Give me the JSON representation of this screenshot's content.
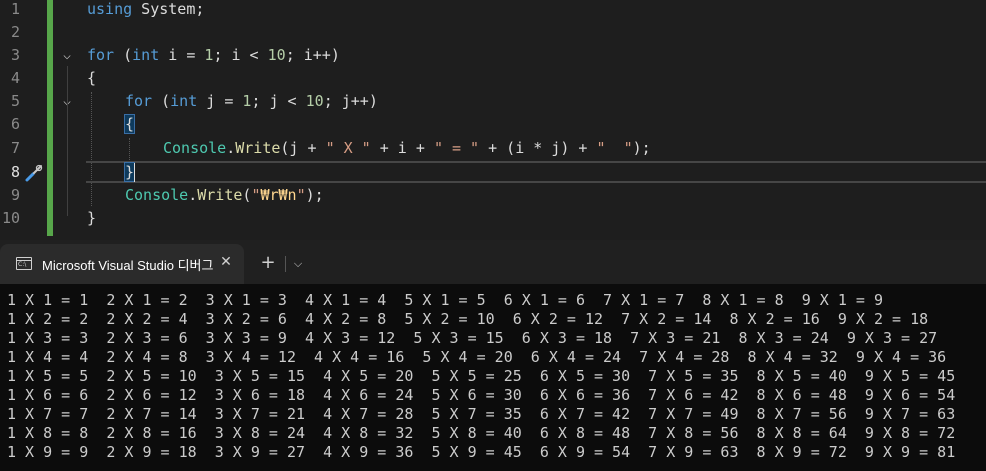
{
  "editor": {
    "line_numbers": [
      "1",
      "2",
      "3",
      "4",
      "5",
      "6",
      "7",
      "8",
      "9",
      "10"
    ],
    "code": {
      "l1_kw": "using",
      "l1_rest": " System;",
      "l3_for": "for",
      "l3_open": " (",
      "l3_int": "int",
      "l3_a": " i = ",
      "l3_n1": "1",
      "l3_b": "; i < ",
      "l3_n2": "10",
      "l3_c": "; i++)",
      "l4": "{",
      "l5_for": "for",
      "l5_open": " (",
      "l5_int": "int",
      "l5_a": " j = ",
      "l5_n1": "1",
      "l5_b": "; j < ",
      "l5_n2": "10",
      "l5_c": "; j++)",
      "l6": "{",
      "l7_type": "Console",
      "l7_dot": ".",
      "l7_method": "Write",
      "l7_a": "(j + ",
      "l7_s1": "\" X \"",
      "l7_b": " + i + ",
      "l7_s2": "\" = \"",
      "l7_c": " + (i * j) + ",
      "l7_s3": "\"  \"",
      "l7_d": ");",
      "l8": "}",
      "l9_type": "Console",
      "l9_dot": ".",
      "l9_method": "Write",
      "l9_a": "(",
      "l9_q1": "\"",
      "l9_esc": "₩r₩n",
      "l9_q2": "\"",
      "l9_b": ");",
      "l10": "}"
    },
    "icons": {
      "fold": "chevron-down-icon",
      "quick_action": "screwdriver-icon"
    },
    "colors": {
      "keyword": "#569cd6",
      "type": "#4ec9b0",
      "method": "#dcdcaa",
      "string": "#d69d85",
      "escape": "#ffd68f",
      "change_bar": "#57a64a"
    }
  },
  "terminal_tab": {
    "title": "Microsoft Visual Studio 디버그",
    "icon_text": "C:\\",
    "close": "✕",
    "new_tab": "+",
    "dropdown": "⌵"
  },
  "output_lines": [
    "1 X 1 = 1  2 X 1 = 2  3 X 1 = 3  4 X 1 = 4  5 X 1 = 5  6 X 1 = 6  7 X 1 = 7  8 X 1 = 8  9 X 1 = 9",
    "1 X 2 = 2  2 X 2 = 4  3 X 2 = 6  4 X 2 = 8  5 X 2 = 10  6 X 2 = 12  7 X 2 = 14  8 X 2 = 16  9 X 2 = 18",
    "1 X 3 = 3  2 X 3 = 6  3 X 3 = 9  4 X 3 = 12  5 X 3 = 15  6 X 3 = 18  7 X 3 = 21  8 X 3 = 24  9 X 3 = 27",
    "1 X 4 = 4  2 X 4 = 8  3 X 4 = 12  4 X 4 = 16  5 X 4 = 20  6 X 4 = 24  7 X 4 = 28  8 X 4 = 32  9 X 4 = 36",
    "1 X 5 = 5  2 X 5 = 10  3 X 5 = 15  4 X 5 = 20  5 X 5 = 25  6 X 5 = 30  7 X 5 = 35  8 X 5 = 40  9 X 5 = 45",
    "1 X 6 = 6  2 X 6 = 12  3 X 6 = 18  4 X 6 = 24  5 X 6 = 30  6 X 6 = 36  7 X 6 = 42  8 X 6 = 48  9 X 6 = 54",
    "1 X 7 = 7  2 X 7 = 14  3 X 7 = 21  4 X 7 = 28  5 X 7 = 35  6 X 7 = 42  7 X 7 = 49  8 X 7 = 56  9 X 7 = 63",
    "1 X 8 = 8  2 X 8 = 16  3 X 8 = 24  4 X 8 = 32  5 X 8 = 40  6 X 8 = 48  7 X 8 = 56  8 X 8 = 64  9 X 8 = 72",
    "1 X 9 = 9  2 X 9 = 18  3 X 9 = 27  4 X 9 = 36  5 X 9 = 45  6 X 9 = 54  7 X 9 = 63  8 X 9 = 72  9 X 9 = 81"
  ]
}
